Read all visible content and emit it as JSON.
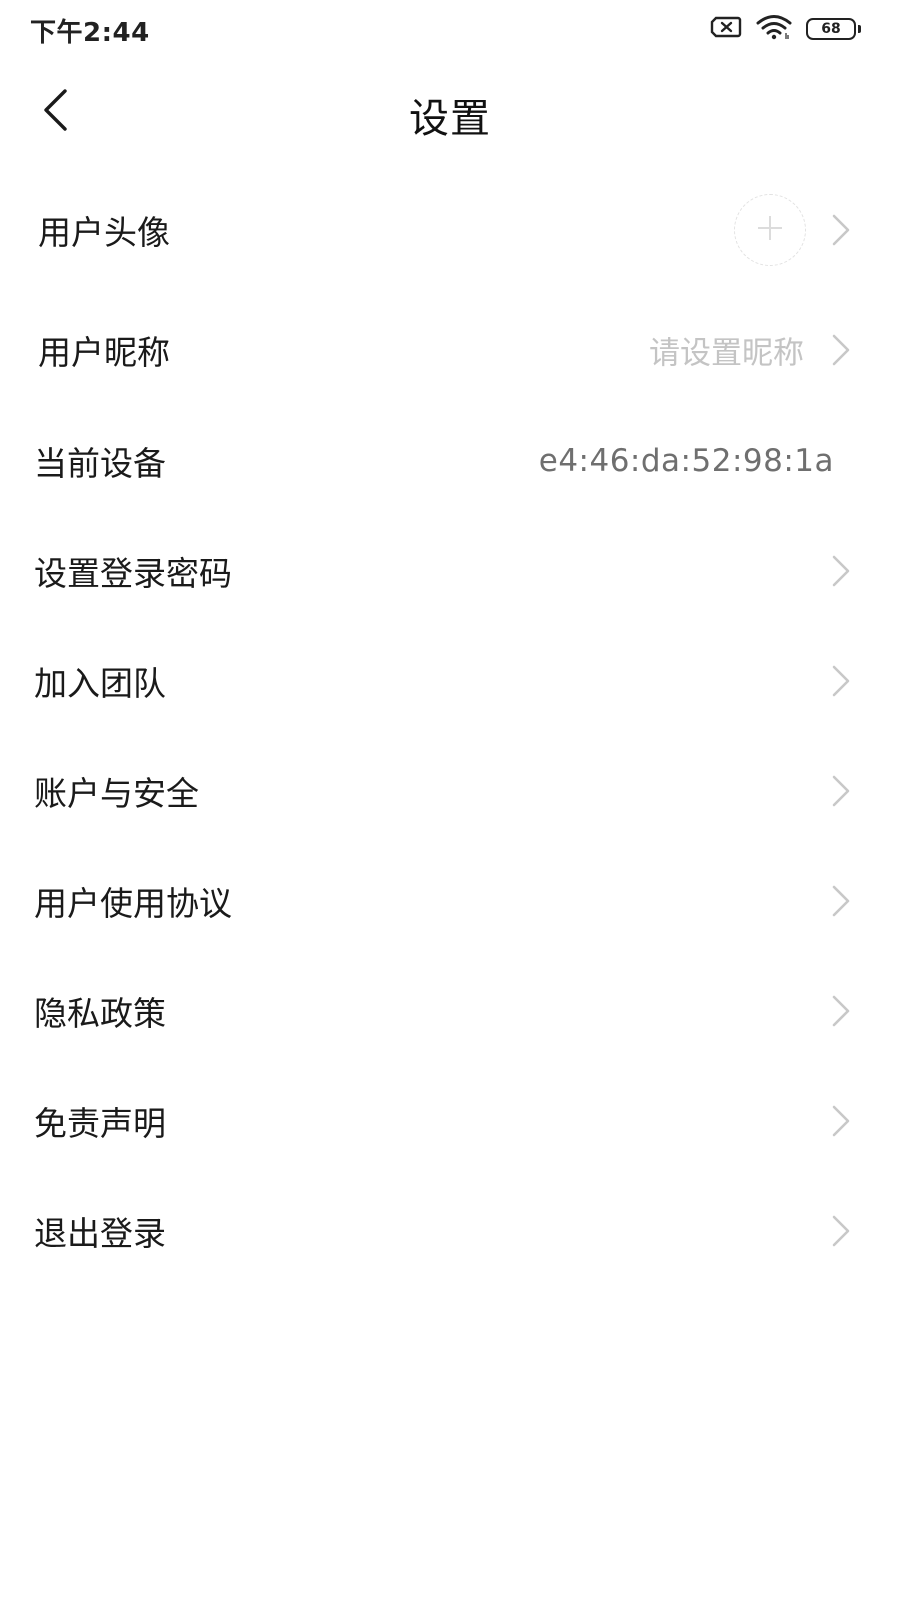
{
  "status_bar": {
    "time": "下午2:44",
    "battery_level": "68",
    "icons": [
      "sim-disabled-icon",
      "wifi-icon",
      "battery-icon"
    ]
  },
  "header": {
    "title": "设置",
    "back_icon": "chevron-left-icon"
  },
  "settings": {
    "avatar": {
      "label": "用户头像",
      "icon": "plus-icon"
    },
    "nickname": {
      "label": "用户昵称",
      "placeholder": "请设置昵称"
    },
    "device": {
      "label": "当前设备",
      "value": "e4:46:da:52:98:1a"
    },
    "password": {
      "label": "设置登录密码"
    },
    "team": {
      "label": "加入团队"
    },
    "account": {
      "label": "账户与安全"
    },
    "agreement": {
      "label": "用户使用协议"
    },
    "privacy": {
      "label": "隐私政策"
    },
    "disclaimer": {
      "label": "免责声明"
    },
    "logout": {
      "label": "退出登录"
    }
  },
  "colors": {
    "text_primary": "#1a1a1a",
    "text_placeholder": "#c4c4c4",
    "text_secondary": "#6f6f6f",
    "chevron": "#c8c8c8",
    "background": "#ffffff"
  }
}
